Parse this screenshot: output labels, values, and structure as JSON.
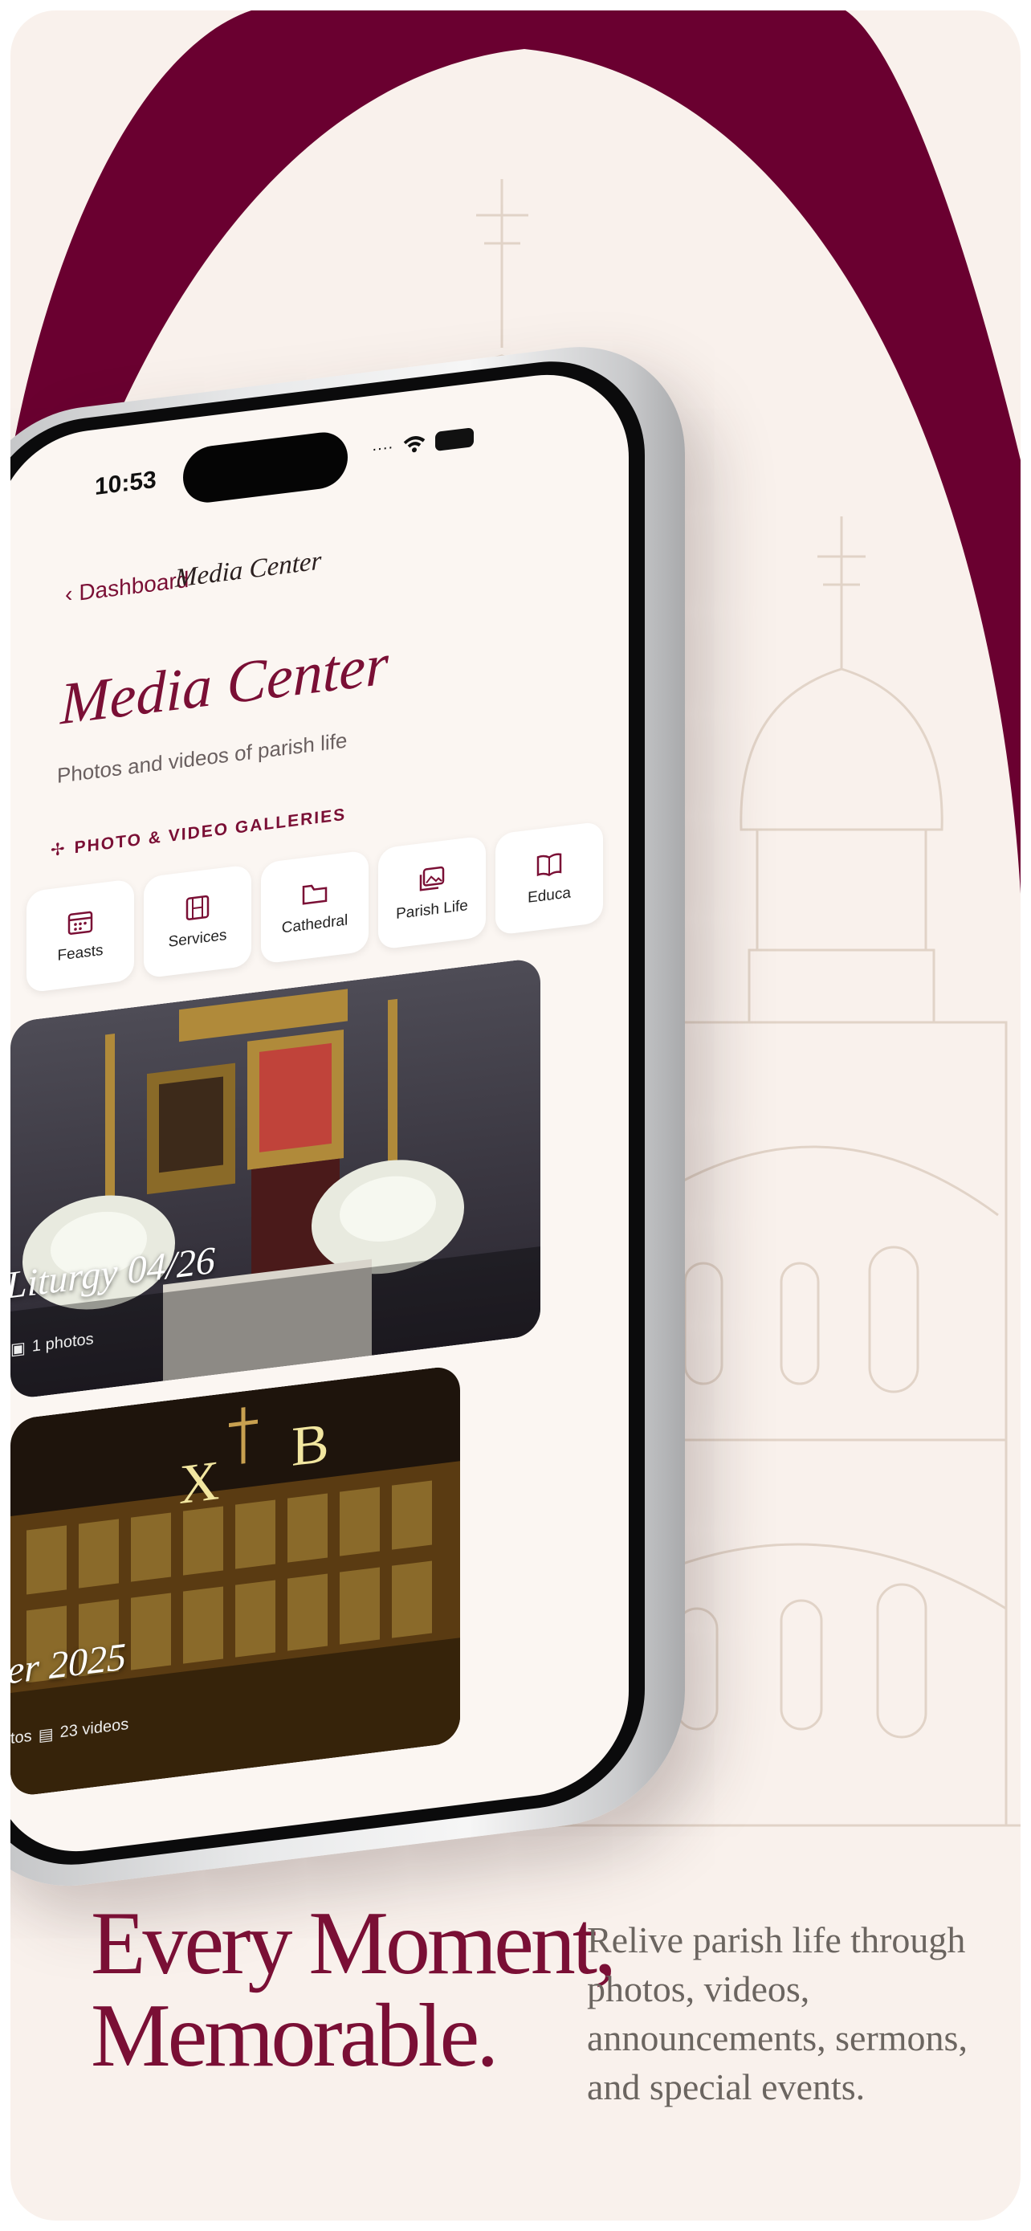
{
  "colors": {
    "accent": "#7a0f35",
    "arch": "#6a0030",
    "background": "#f9f1ec",
    "body_text": "#6b6560"
  },
  "status_bar": {
    "time": "10:53"
  },
  "nav": {
    "back_label": "Dashboard",
    "title": "Media Center"
  },
  "page": {
    "title": "Media Center",
    "subtitle": "Photos and videos of parish life"
  },
  "section": {
    "label": "PHOTO & VIDEO GALLERIES",
    "icon": "cross-icon"
  },
  "categories": [
    {
      "label": "Feasts",
      "icon": "calendar-icon"
    },
    {
      "label": "Services",
      "icon": "film-icon"
    },
    {
      "label": "Cathedral",
      "icon": "folder-icon"
    },
    {
      "label": "Parish Life",
      "icon": "photos-icon"
    },
    {
      "label": "Educa",
      "icon": "book-icon"
    }
  ],
  "galleries": [
    {
      "title": "Liturgy 04/26",
      "meta_photos": "1 photos"
    },
    {
      "title": "er 2025",
      "meta_photos": "tos",
      "meta_videos": "23 videos"
    }
  ],
  "marketing": {
    "headline_line1": "Every Moment,",
    "headline_line2": "Memorable.",
    "body": "Relive parish life through photos, videos, announcements, sermons, and special events."
  }
}
